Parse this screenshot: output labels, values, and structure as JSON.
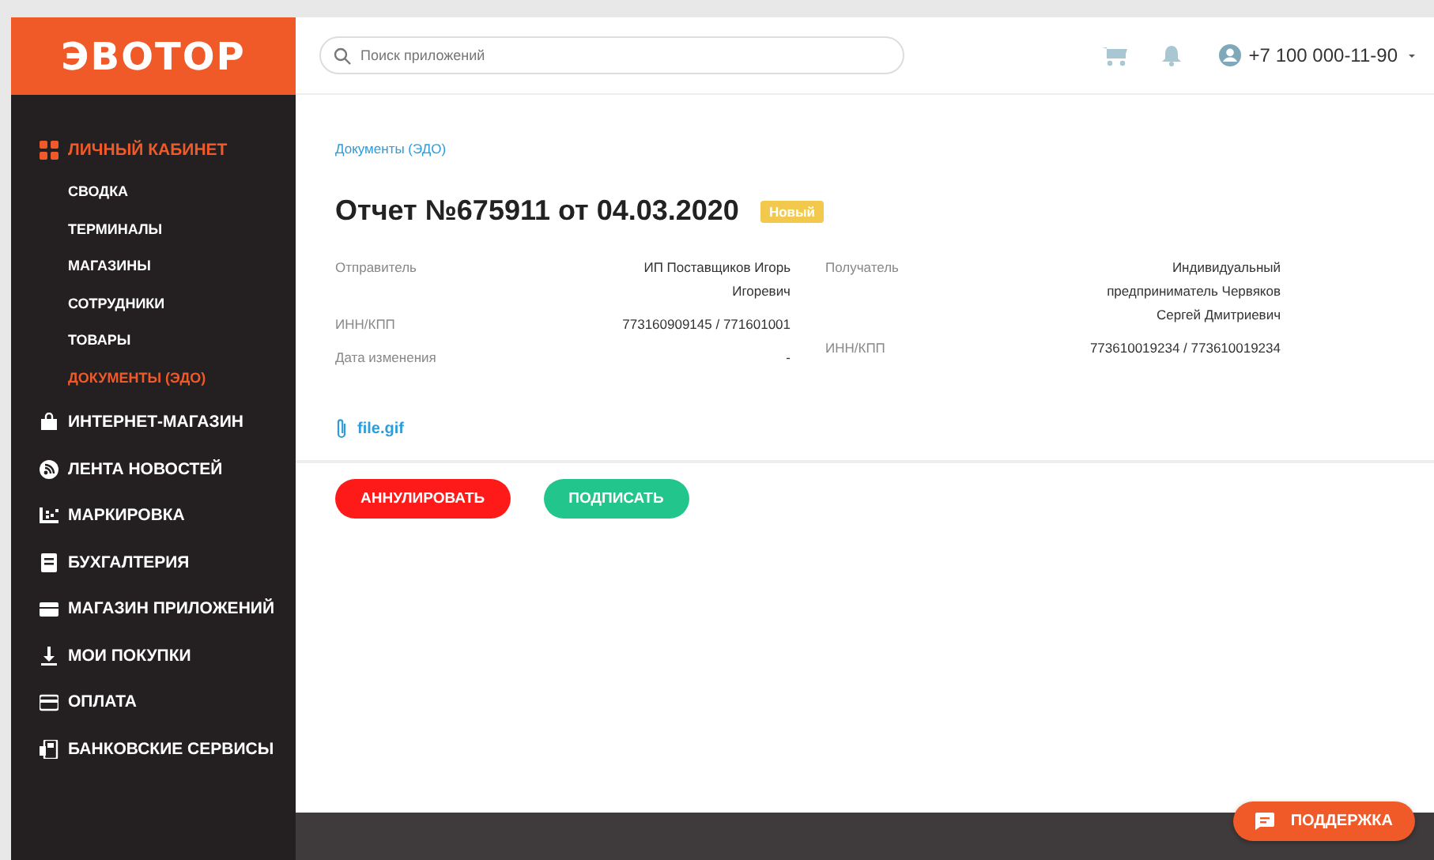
{
  "logo": "ЭВОТОР",
  "search": {
    "placeholder": "Поиск приложений"
  },
  "user": {
    "phone": "+7 100 000-11-90"
  },
  "sidebar": {
    "items": [
      {
        "label": "ЛИЧНЫЙ КАБИНЕТ",
        "selected": true,
        "children": [
          {
            "label": "СВОДКА",
            "selected": false
          },
          {
            "label": "ТЕРМИНАЛЫ",
            "selected": false
          },
          {
            "label": "МАГАЗИНЫ",
            "selected": false
          },
          {
            "label": "СОТРУДНИКИ",
            "selected": false
          },
          {
            "label": "ТОВАРЫ",
            "selected": false
          },
          {
            "label": "ДОКУМЕНТЫ (ЭДО)",
            "selected": true
          }
        ]
      },
      {
        "label": "ИНТЕРНЕТ-МАГАЗИН",
        "selected": false
      },
      {
        "label": "ЛЕНТА НОВОСТЕЙ",
        "selected": false
      },
      {
        "label": "МАРКИРОВКА",
        "selected": false
      },
      {
        "label": "БУХГАЛТЕРИЯ",
        "selected": false
      },
      {
        "label": "МАГАЗИН ПРИЛОЖЕНИЙ",
        "selected": false
      },
      {
        "label": "МОИ ПОКУПКИ",
        "selected": false
      },
      {
        "label": "ОПЛАТА",
        "selected": false
      },
      {
        "label": "БАНКОВСКИЕ СЕРВИСЫ",
        "selected": false
      }
    ]
  },
  "breadcrumb": "Документы (ЭДО)",
  "title": "Отчет №675911 от 04.03.2020",
  "status_badge": "Новый",
  "sender": [
    {
      "label": "Отправитель",
      "value": "ИП Поставщиков Игорь Игоревич"
    },
    {
      "label": "ИНН/КПП",
      "value": "773160909145 / 771601001"
    },
    {
      "label": "Дата изменения",
      "value": "-"
    }
  ],
  "recipient": [
    {
      "label": "Получатель",
      "value": "Индивидуальный предприниматель Червяков Сергей Дмитриевич"
    },
    {
      "label": "ИНН/КПП",
      "value": "773610019234 / 773610019234"
    }
  ],
  "attachment": "file.gif",
  "actions": [
    {
      "label": "АННУЛИРОВАТЬ",
      "kind": "danger"
    },
    {
      "label": "ПОДПИСАТЬ",
      "kind": "success"
    }
  ],
  "support_button": "ПОДДЕРЖКА"
}
